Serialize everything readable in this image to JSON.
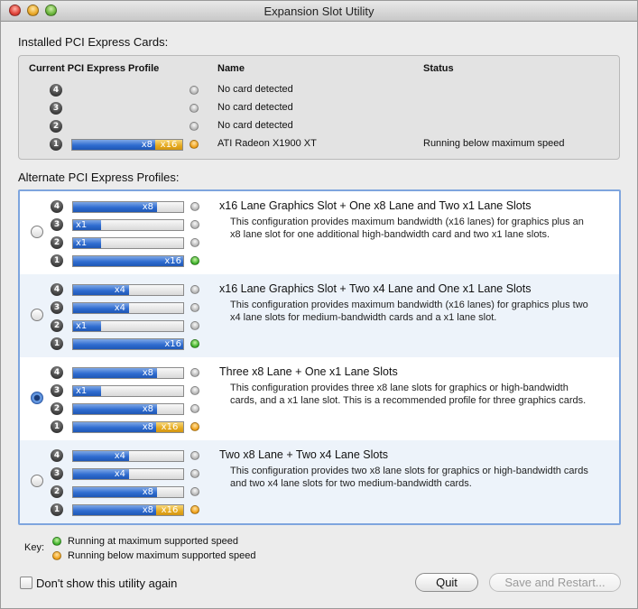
{
  "window": {
    "title": "Expansion Slot Utility"
  },
  "installed": {
    "label": "Installed PCI Express Cards:",
    "col_profile": "Current PCI Express Profile",
    "col_name": "Name",
    "col_status": "Status",
    "rows": [
      {
        "slot": "4",
        "name": "No card detected",
        "status": "",
        "bar": "",
        "gold": ""
      },
      {
        "slot": "3",
        "name": "No card detected",
        "status": "",
        "bar": "",
        "gold": ""
      },
      {
        "slot": "2",
        "name": "No card detected",
        "status": "",
        "bar": "",
        "gold": ""
      },
      {
        "slot": "1",
        "name": "ATI Radeon X1900 XT",
        "status": "Running below maximum speed",
        "bar": "x8",
        "gold": "x16"
      }
    ]
  },
  "alternate": {
    "label": "Alternate PCI Express Profiles:",
    "profiles": [
      {
        "title": "x16 Lane Graphics Slot + One x8 Lane and Two x1 Lane Slots",
        "desc": "This configuration provides maximum bandwidth (x16 lanes) for graphics plus an x8 lane slot for one additional high-bandwidth card and two x1 lane slots.",
        "selected": false,
        "slots": [
          {
            "n": "4",
            "label": "x8",
            "fill": 0.75,
            "gold": "",
            "status": "grey"
          },
          {
            "n": "3",
            "label": "x1",
            "fill": 0.25,
            "gold": "",
            "status": "grey"
          },
          {
            "n": "2",
            "label": "x1",
            "fill": 0.25,
            "gold": "",
            "status": "grey"
          },
          {
            "n": "1",
            "label": "x16",
            "fill": 1.0,
            "gold": "",
            "status": "green"
          }
        ]
      },
      {
        "title": "x16 Lane Graphics Slot + Two x4 Lane and One x1 Lane Slots",
        "desc": "This configuration provides maximum bandwidth (x16 lanes) for graphics plus two x4 lane slots for medium-bandwidth cards and a x1 lane slot.",
        "selected": false,
        "slots": [
          {
            "n": "4",
            "label": "x4",
            "fill": 0.5,
            "gold": "",
            "status": "grey"
          },
          {
            "n": "3",
            "label": "x4",
            "fill": 0.5,
            "gold": "",
            "status": "grey"
          },
          {
            "n": "2",
            "label": "x1",
            "fill": 0.25,
            "gold": "",
            "status": "grey"
          },
          {
            "n": "1",
            "label": "x16",
            "fill": 1.0,
            "gold": "",
            "status": "green"
          }
        ]
      },
      {
        "title": "Three x8 Lane + One x1 Lane Slots",
        "desc": "This configuration provides three x8 lane slots for graphics or high-bandwidth cards, and a x1 lane slot.  This is a recommended profile for three graphics cards.",
        "selected": true,
        "slots": [
          {
            "n": "4",
            "label": "x8",
            "fill": 0.75,
            "gold": "",
            "status": "grey"
          },
          {
            "n": "3",
            "label": "x1",
            "fill": 0.25,
            "gold": "",
            "status": "grey"
          },
          {
            "n": "2",
            "label": "x8",
            "fill": 0.75,
            "gold": "",
            "status": "grey"
          },
          {
            "n": "1",
            "label": "x8",
            "fill": 0.75,
            "gold": "x16",
            "status": "orange"
          }
        ]
      },
      {
        "title": "Two x8 Lane + Two x4 Lane Slots",
        "desc": "This configuration provides two x8 lane slots for graphics or high-bandwidth cards and two x4 lane slots for two medium-bandwidth cards.",
        "selected": false,
        "slots": [
          {
            "n": "4",
            "label": "x4",
            "fill": 0.5,
            "gold": "",
            "status": "grey"
          },
          {
            "n": "3",
            "label": "x4",
            "fill": 0.5,
            "gold": "",
            "status": "grey"
          },
          {
            "n": "2",
            "label": "x8",
            "fill": 0.75,
            "gold": "",
            "status": "grey"
          },
          {
            "n": "1",
            "label": "x8",
            "fill": 0.75,
            "gold": "x16",
            "status": "orange"
          }
        ]
      }
    ]
  },
  "key": {
    "label": "Key:",
    "green": "Running at maximum supported speed",
    "orange": "Running below maximum supported speed"
  },
  "footer": {
    "dont_show": "Don't show this utility again",
    "quit": "Quit",
    "save": "Save and Restart..."
  },
  "colors": {
    "accent": "#2f6cd0",
    "gold": "#e5a91f",
    "green": "#3fb32c",
    "orange": "#f0a21b"
  }
}
